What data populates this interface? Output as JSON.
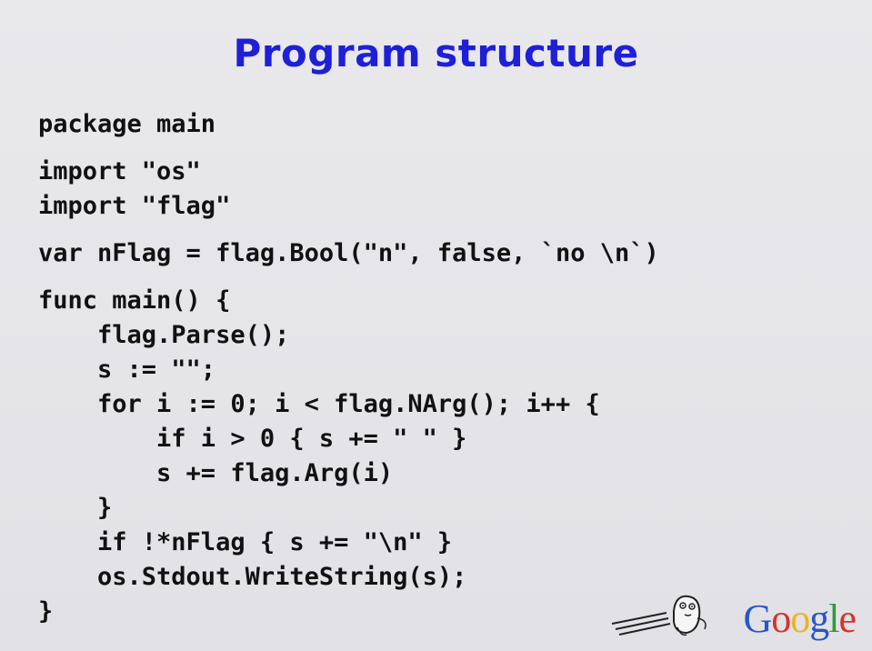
{
  "title": "Program structure",
  "code_lines": [
    "package main",
    "",
    "import \"os\"",
    "import \"flag\"",
    "",
    "var nFlag = flag.Bool(\"n\", false, `no \\n`)",
    "",
    "func main() {",
    "    flag.Parse();",
    "    s := \"\";",
    "    for i := 0; i < flag.NArg(); i++ {",
    "        if i > 0 { s += \" \" }",
    "        s += flag.Arg(i)",
    "    }",
    "    if !*nFlag { s += \"\\n\" }",
    "    os.Stdout.WriteString(s);",
    "}"
  ],
  "logo": {
    "text": "Google",
    "letters": [
      {
        "ch": "G",
        "color": "#2b55c8"
      },
      {
        "ch": "o",
        "color": "#d8322a"
      },
      {
        "ch": "o",
        "color": "#e8b624"
      },
      {
        "ch": "g",
        "color": "#2b55c8"
      },
      {
        "ch": "l",
        "color": "#2f9a3a"
      },
      {
        "ch": "e",
        "color": "#d8322a"
      }
    ]
  },
  "colors": {
    "title": "#1f1fd8",
    "code": "#111111",
    "background": "#e6e6e9"
  }
}
